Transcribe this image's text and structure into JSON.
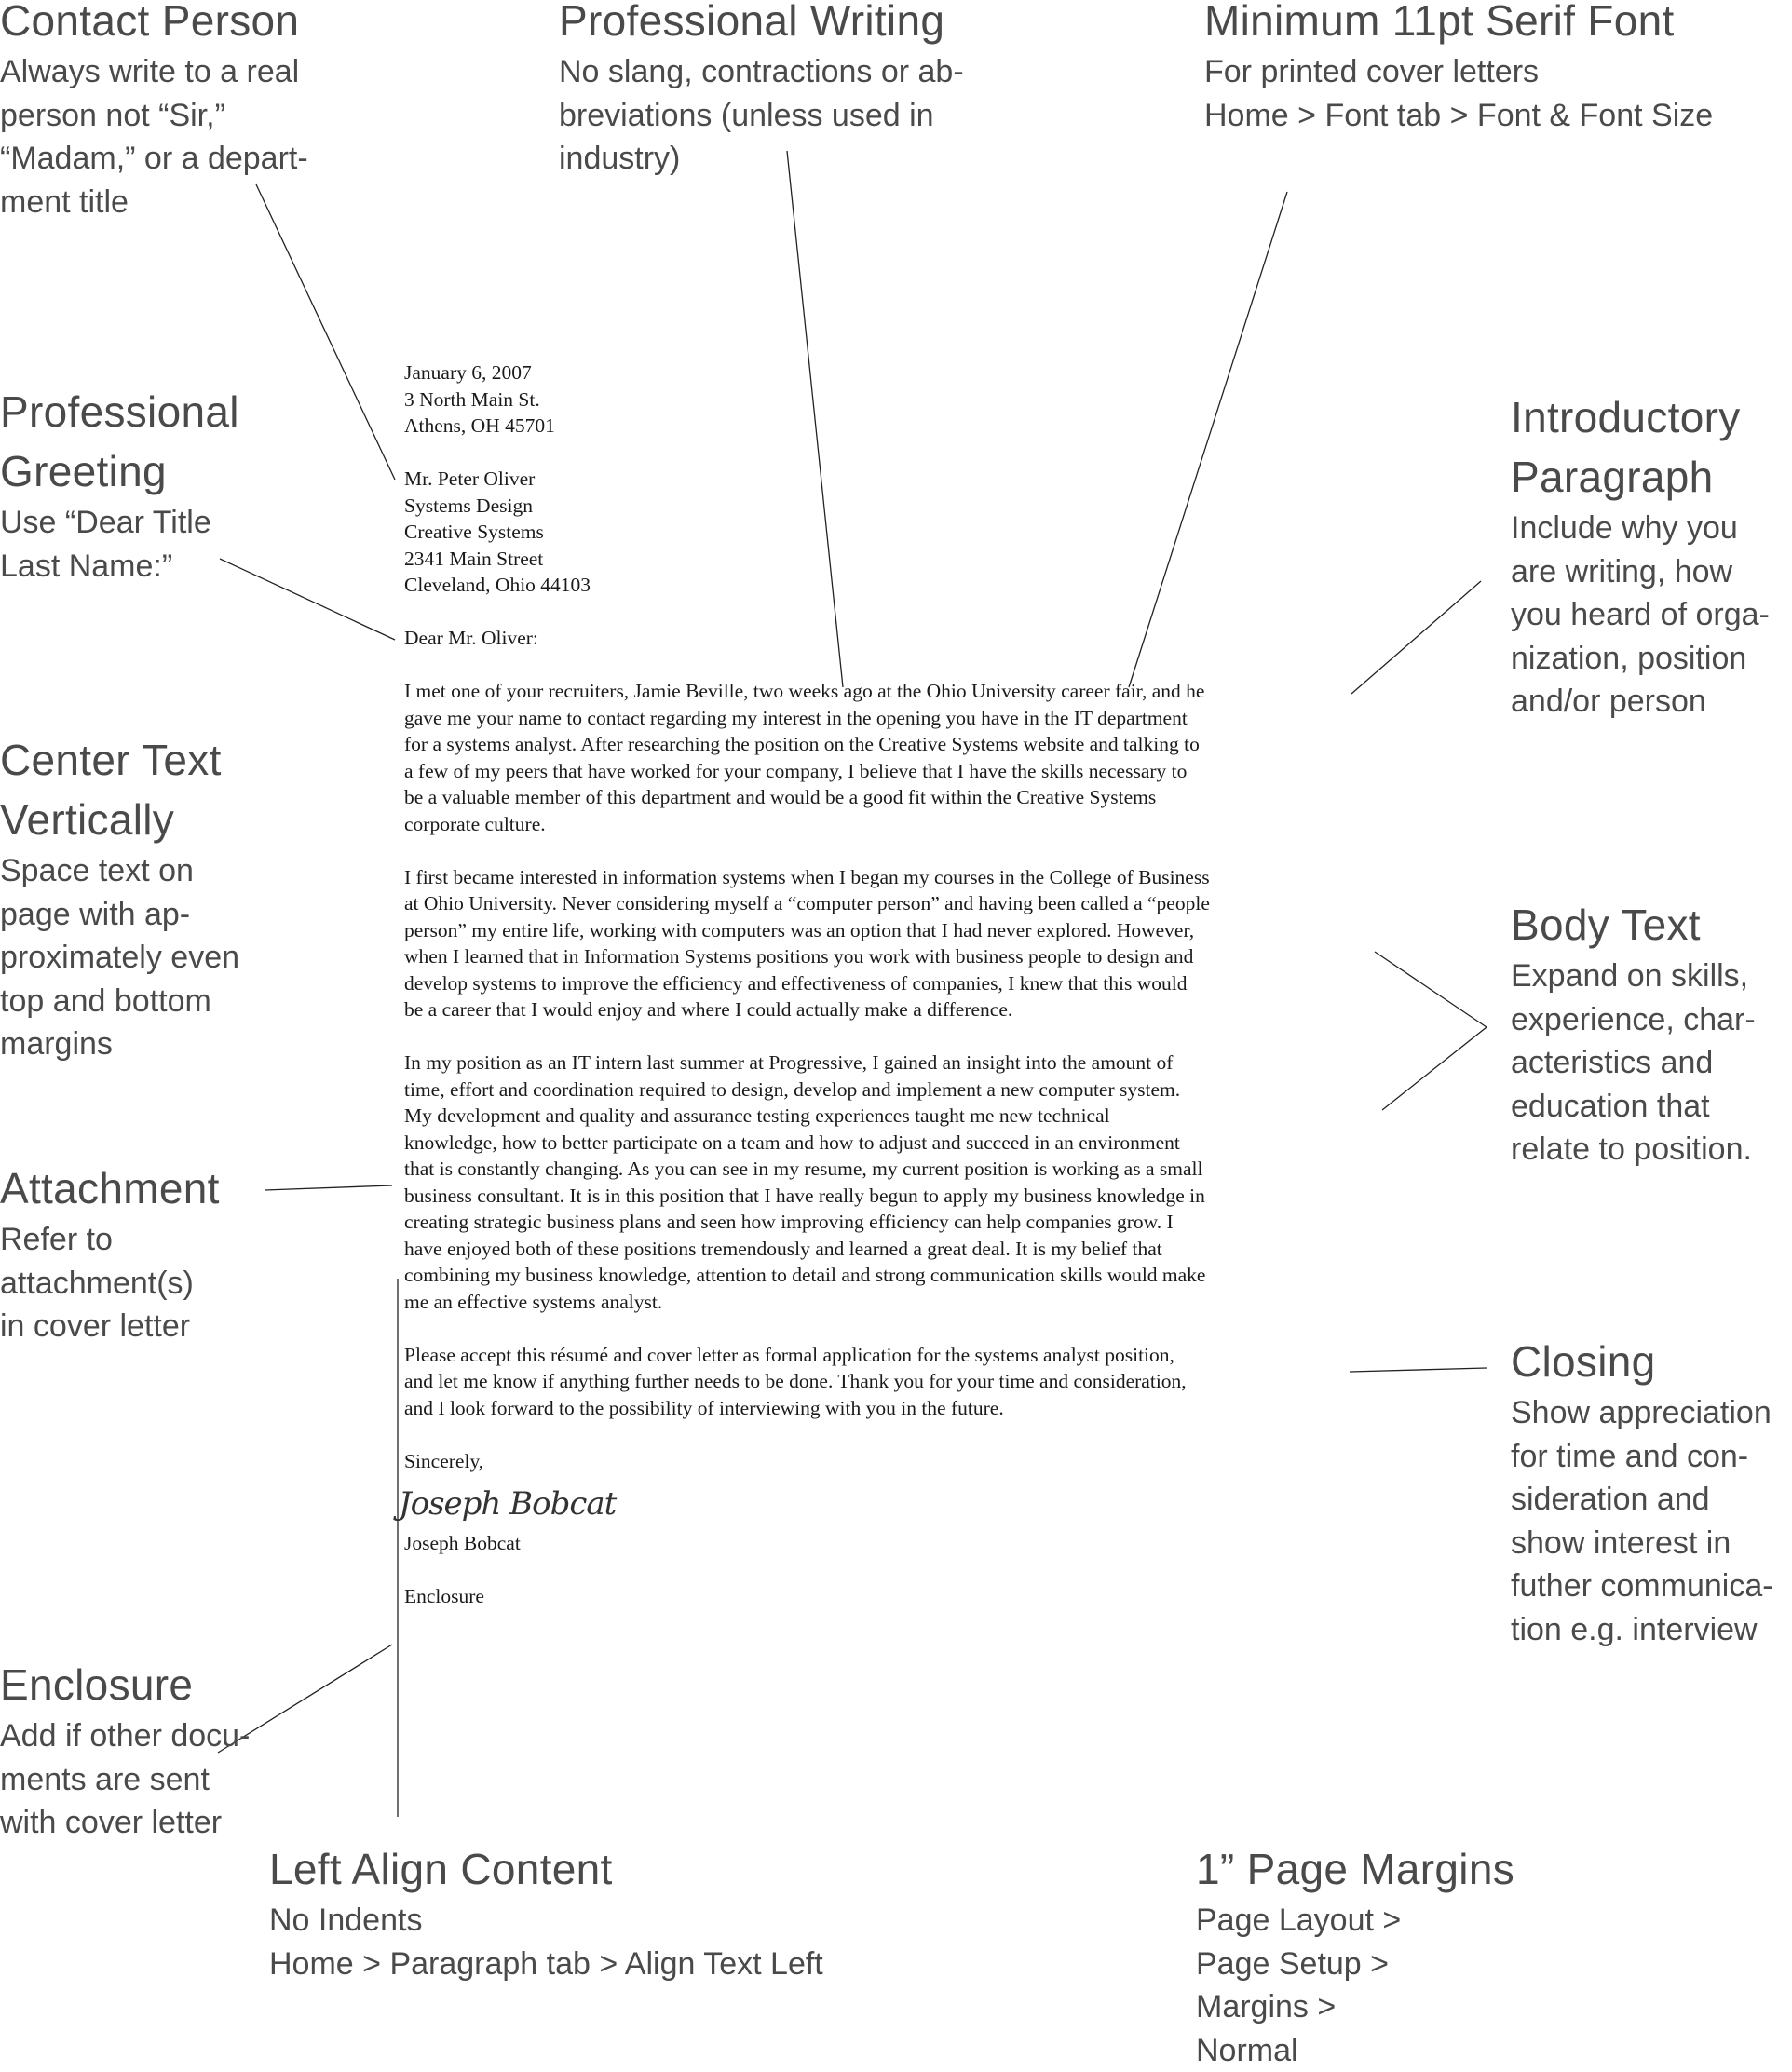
{
  "annotations": {
    "contact_person": {
      "title": "Contact Person",
      "desc": "Always write to a real\nperson not “Sir,”\n“Madam,” or a depart-\nment title"
    },
    "professional_writing": {
      "title": "Professional Writing",
      "desc": "No slang, contractions or ab-\nbreviations (unless used in\nindustry)"
    },
    "serif_font": {
      "title": "Minimum 11pt Serif Font",
      "desc": "For printed cover letters\nHome > Font tab > Font & Font Size"
    },
    "professional_greeting": {
      "title_line1": "Professional",
      "title_line2": "Greeting",
      "desc": "Use “Dear Title\nLast Name:”"
    },
    "center_text": {
      "title_line1": "Center Text",
      "title_line2": "Vertically",
      "desc": "Space text on\npage with ap-\nproximately even\ntop and bottom\nmargins"
    },
    "attachment": {
      "title": "Attachment",
      "desc": "Refer to\nattachment(s)\nin cover letter"
    },
    "enclosure": {
      "title": "Enclosure",
      "desc": "Add if other docu-\nments are sent\nwith cover letter"
    },
    "introductory_paragraph": {
      "title_line1": "Introductory",
      "title_line2": "Paragraph",
      "desc": "Include why you\nare writing, how\nyou heard of orga-\nnization, position\nand/or person"
    },
    "body_text": {
      "title": "Body Text",
      "desc": "Expand on skills,\nexperience, char-\nacteristics and\neducation that\nrelate to position."
    },
    "closing": {
      "title": "Closing",
      "desc": "Show appreciation\nfor time and con-\nsideration and\nshow interest in\nfuther communica-\ntion e.g. interview"
    },
    "left_align": {
      "title": "Left Align Content",
      "desc": "No Indents\nHome > Paragraph tab > Align Text Left"
    },
    "page_margins": {
      "title": "1” Page Margins",
      "desc": "Page Layout >\nPage Setup >\nMargins >\nNormal"
    }
  },
  "letter": {
    "date": "January 6, 2007",
    "sender_address": [
      "3 North Main St.",
      "Athens, OH 45701"
    ],
    "recipient": [
      "Mr. Peter Oliver",
      "Systems Design",
      "Creative Systems",
      "2341 Main Street",
      "Cleveland, Ohio  44103"
    ],
    "salutation": "Dear Mr. Oliver:",
    "paragraphs": [
      "I met one of your recruiters, Jamie Beville, two weeks ago at the Ohio University career fair, and he\ngave me your name to contact regarding my interest in the opening you have in the IT department\nfor a systems analyst. After researching the position on the Creative Systems website and talking to\na few of my peers that have worked for your company, I believe that I have the skills necessary to\nbe a valuable member of this department and would be a good fit within the Creative Systems\ncorporate culture.",
      "I first became interested in information systems when I began my courses in the College of Business\nat Ohio University. Never considering myself a “computer person” and having been called a “people\nperson” my entire life, working with computers was an option that I had never explored. However,\nwhen I learned that in Information Systems positions you work with business people to design and\ndevelop systems to improve the efficiency and effectiveness of companies, I knew that this would\nbe a career that I would enjoy and where I could actually make a difference.",
      "In my position as an IT intern last summer at Progressive, I gained an insight into the amount of\ntime, effort and coordination required to design, develop and implement a new computer system.\nMy development and quality and assurance testing experiences taught me new technical\nknowledge, how to better participate on a team and how to adjust and succeed in an environment\nthat is constantly changing. As you can see in my resume, my current position is working as a small\nbusiness consultant. It is in this position that I have really begun to apply my business knowledge in\ncreating strategic business plans and seen how improving efficiency can help companies grow. I\nhave enjoyed both of these positions tremendously and learned a great deal. It is my belief that\ncombining my business knowledge, attention to detail and strong communication skills would make\nme an effective systems analyst.",
      "Please accept this résumé and cover letter as formal application for the systems analyst position,\nand let me know if anything further needs to be done. Thank you for your time and consideration,\nand I look forward to the possibility of interviewing with you in the future."
    ],
    "closing": "Sincerely,",
    "signature": "Joseph Bobcat",
    "signer_name": "Joseph Bobcat",
    "enclosure": "Enclosure"
  }
}
